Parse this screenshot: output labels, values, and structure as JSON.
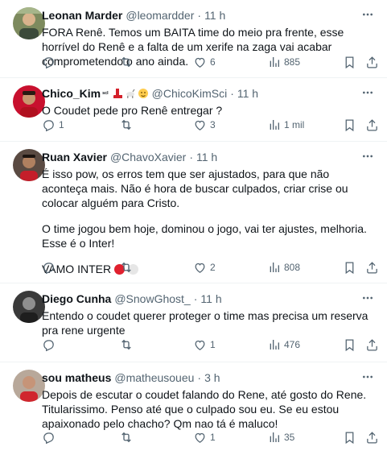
{
  "tweets": [
    {
      "name": "Leonan Marder",
      "handle": "@leomardder",
      "dot": "·",
      "time": "11 h",
      "lines": [
        "FORA Renê. Temos um BAITA time do meio pra frente, esse horrível do Renê e a falta de um xerife na zaga vai acabar comprometendo o ano ainda."
      ],
      "replies": "",
      "retweets": "",
      "likes": "6",
      "views": "885"
    },
    {
      "name": "Chico_Kim",
      "name_suffix": "ˢᶜᴵ",
      "handle": "@ChicoKimSci",
      "dot": "·",
      "time": "11 h",
      "lines": [
        "O Coudet pede pro Renê entregar ?"
      ],
      "replies": "1",
      "retweets": "",
      "likes": "3",
      "views": "1 mil"
    },
    {
      "name": "Ruan Xavier",
      "handle": "@ChavoXavier",
      "dot": "·",
      "time": "11 h",
      "lines": [
        "É isso pow, os erros tem que ser ajustados, para que não aconteça mais. Não é hora de buscar culpados, criar crise ou colocar alguém para Cristo.",
        "O time jogou bem hoje, dominou o jogo, vai ter ajustes, melhoria. Esse é o Inter!",
        "VAMO INTER"
      ],
      "replies": "",
      "retweets": "",
      "likes": "2",
      "views": "808"
    },
    {
      "name": "Diego Cunha",
      "handle": "@SnowGhost_",
      "dot": "·",
      "time": "11 h",
      "lines": [
        "Entendo o coudet querer proteger o time mas precisa um reserva pra rene urgente"
      ],
      "replies": "",
      "retweets": "",
      "likes": "1",
      "views": "476"
    },
    {
      "name": "sou matheus",
      "handle": "@matheusoueu",
      "dot": "·",
      "time": "3 h",
      "lines": [
        "Depois de escutar o coudet falando do Rene, até gosto do Rene. Titularissimo. Penso até que o culpado sou eu. Se eu estou apaixonado pelo chacho? Qm nao tá é maluco!"
      ],
      "replies": "",
      "retweets": "",
      "likes": "1",
      "views": "35"
    }
  ],
  "colors": {
    "text": "#0f1419",
    "secondary": "#536471",
    "divider": "#eff3f4",
    "inter_red": "#e0202e"
  },
  "icons": [
    "more-icon",
    "reply-icon",
    "retweet-icon",
    "like-icon",
    "views-icon",
    "bookmark-icon",
    "share-icon"
  ]
}
